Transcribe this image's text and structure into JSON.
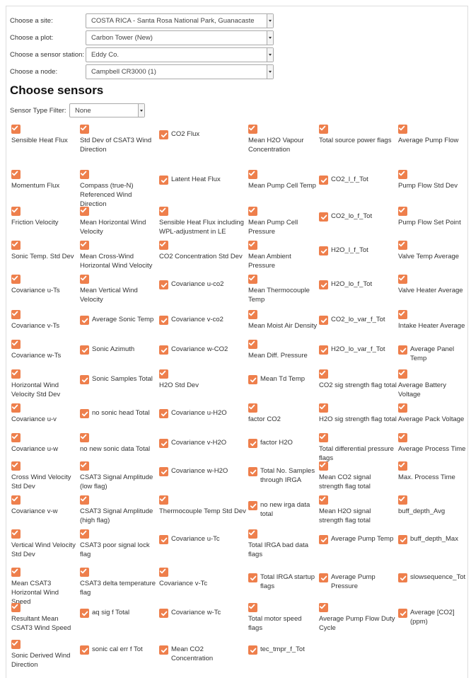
{
  "form": {
    "site_label": "Choose a site:",
    "site_value": "COSTA RICA - Santa Rosa National Park, Guanacaste",
    "plot_label": "Choose a plot:",
    "plot_value": "Carbon Tower (New)",
    "station_label": "Choose a sensor station:",
    "station_value": "Eddy Co.",
    "node_label": "Choose a node:",
    "node_value": "Campbell CR3000 (1)"
  },
  "sensors_heading": "Choose sensors",
  "filter": {
    "label": "Sensor Type Filter:",
    "value": "None"
  },
  "accent_color": "#ee7f4c",
  "icons": {
    "checkbox": "checkmark-icon",
    "dropdown": "chevron-down-icon"
  },
  "columns": [
    [
      "Sensible Heat Flux",
      "Momentum Flux",
      "Friction Velocity",
      "Sonic Temp. Std Dev",
      "Covariance u-Ts",
      "Covariance v-Ts",
      "Covariance w-Ts",
      "Horizontal Wind Velocity Std Dev",
      "Covariance u-v",
      "Covariance u-w",
      "Cross Wind Velocity Std Dev",
      "Covariance v-w",
      "Vertical Wind Velocity Std Dev",
      "Mean CSAT3 Horizontal Wind Speed",
      "Resultant Mean CSAT3 Wind Speed",
      "Sonic Derived Wind Direction"
    ],
    [
      "Std Dev of CSAT3 Wind Direction",
      "Compass (true-N) Referenced Wind Direction",
      "Mean Horizontal Wind Velocity",
      "Mean Cross-Wind Horizontal Wind Velocity",
      "Mean Vertical Wind Velocity",
      "Average Sonic Temp",
      "Sonic Azimuth",
      "Sonic Samples Total",
      "no sonic head Total",
      "no new sonic data Total",
      "CSAT3 Signal Amplitude (low flag)",
      "CSAT3 Signal Amplitude (high flag)",
      "CSAT3 poor signal lock flag",
      "CSAT3 delta temperature flag",
      "aq sig f Total",
      "sonic cal err f Tot"
    ],
    [
      "CO2 Flux",
      "Latent Heat Flux",
      "Sensible Heat Flux including WPL-adjustment in LE",
      "CO2 Concentration Std Dev",
      "Covariance u-co2",
      "Covariance v-co2",
      "Covariance w-CO2",
      "H2O Std Dev",
      "Covariance u-H2O",
      "Covariance v-H2O",
      "Covariance w-H2O",
      "Thermocouple Temp Std Dev",
      "Covariance u-Tc",
      "Covariance v-Tc",
      "Covariance w-Tc",
      "Mean CO2 Concentration"
    ],
    [
      "Mean H2O Vapour Concentration",
      "Mean Pump Cell Temp",
      "Mean Pump Cell Pressure",
      "Mean Ambient Pressure",
      "Mean Thermocouple Temp",
      "Mean Moist Air Density",
      "Mean Diff. Pressure",
      "Mean Td Temp",
      "factor CO2",
      "factor H2O",
      "Total No. Samples through IRGA",
      "no new irga data total",
      "Total IRGA bad data flags",
      "Total IRGA startup flags",
      "Total motor speed flags",
      "tec_tmpr_f_Tot"
    ],
    [
      "Total source power flags",
      "CO2_l_f_Tot",
      "CO2_lo_f_Tot",
      "H2O_l_f_Tot",
      "H2O_lo_f_Tot",
      "CO2_lo_var_f_Tot",
      "H2O_lo_var_f_Tot",
      "CO2 sig strength flag total",
      "H2O sig strength flag total",
      "Total differential pressure flags",
      "Mean CO2 signal strength flag total",
      "Mean H2O signal strength flag total",
      "Average Pump Temp",
      "Average Pump Pressure",
      "Average Pump Flow Duty Cycle"
    ],
    [
      "Average Pump Flow",
      "Pump Flow Std Dev",
      "Pump Flow Set Point",
      "Valve Temp Average",
      "Valve Heater Average",
      "Intake Heater Average",
      "Average Panel Temp",
      "Average Battery Voltage",
      "Average Pack Voltage",
      "Average Process Time",
      "Max. Process Time",
      "buff_depth_Avg",
      "buff_depth_Max",
      "slowsequence_Tot",
      "Average [CO2] (ppm)"
    ]
  ]
}
